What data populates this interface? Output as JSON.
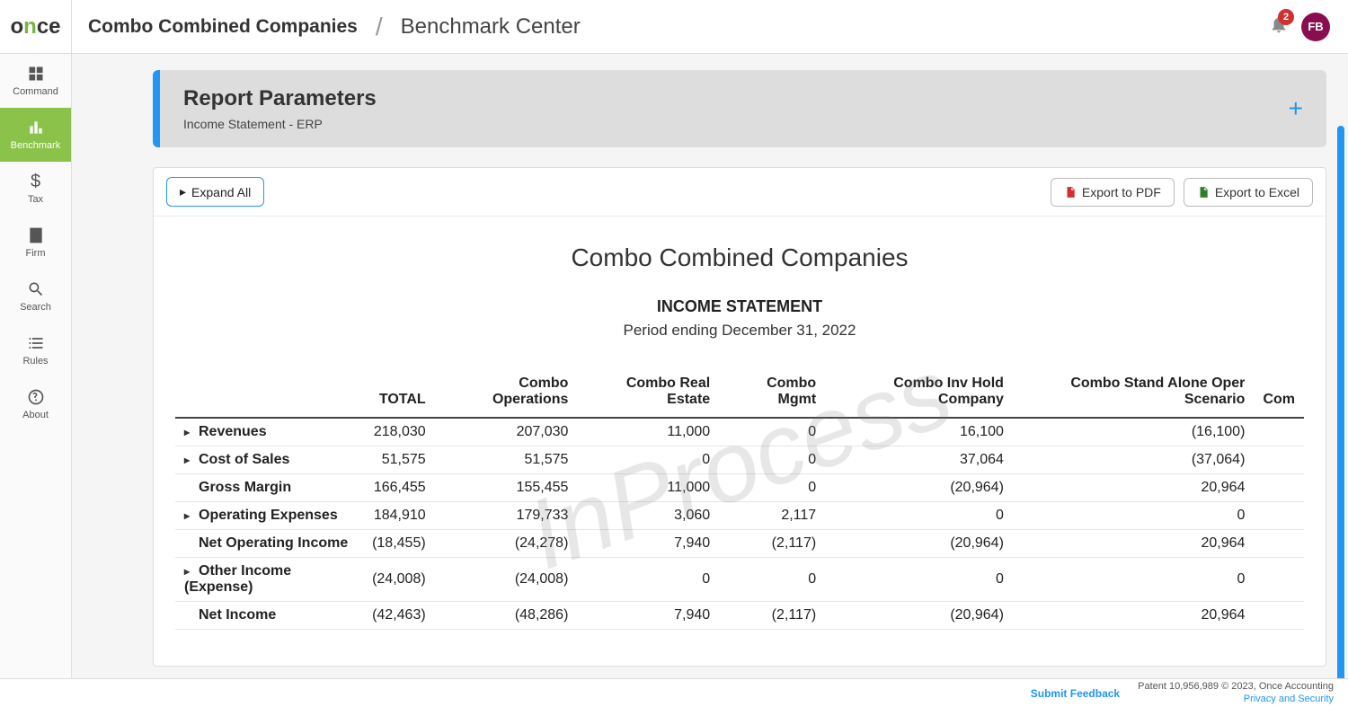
{
  "brand": {
    "prefix": "o",
    "mid": "n",
    "suffix": "ce"
  },
  "header": {
    "company": "Combo Combined Companies",
    "page": "Benchmark Center",
    "notif_count": "2",
    "avatar_initials": "FB"
  },
  "sidebar": {
    "items": [
      {
        "key": "command",
        "label": "Command"
      },
      {
        "key": "benchmark",
        "label": "Benchmark"
      },
      {
        "key": "tax",
        "label": "Tax"
      },
      {
        "key": "firm",
        "label": "Firm"
      },
      {
        "key": "search",
        "label": "Search"
      },
      {
        "key": "rules",
        "label": "Rules"
      },
      {
        "key": "about",
        "label": "About"
      }
    ],
    "active": "benchmark"
  },
  "params": {
    "title": "Report Parameters",
    "subtitle": "Income Statement - ERP"
  },
  "toolbar": {
    "expand_label": "Expand All",
    "export_pdf_label": "Export to PDF",
    "export_excel_label": "Export to Excel"
  },
  "report": {
    "company": "Combo Combined Companies",
    "statement": "INCOME STATEMENT",
    "period": "Period ending December 31, 2022",
    "watermark": "InProcess",
    "columns": [
      "",
      "TOTAL",
      "Combo Operations",
      "Combo Real Estate",
      "Combo Mgmt",
      "Combo Inv Hold Company",
      "Combo Stand Alone Oper Scenario",
      "Com"
    ],
    "rows": [
      {
        "label": "Revenues",
        "expandable": true,
        "values": [
          "218,030",
          "207,030",
          "11,000",
          "0",
          "16,100",
          "(16,100)",
          ""
        ]
      },
      {
        "label": "Cost of Sales",
        "expandable": true,
        "values": [
          "51,575",
          "51,575",
          "0",
          "0",
          "37,064",
          "(37,064)",
          ""
        ]
      },
      {
        "label": "Gross Margin",
        "expandable": false,
        "values": [
          "166,455",
          "155,455",
          "11,000",
          "0",
          "(20,964)",
          "20,964",
          ""
        ]
      },
      {
        "label": "Operating Expenses",
        "expandable": true,
        "values": [
          "184,910",
          "179,733",
          "3,060",
          "2,117",
          "0",
          "0",
          ""
        ]
      },
      {
        "label": "Net Operating Income",
        "expandable": false,
        "values": [
          "(18,455)",
          "(24,278)",
          "7,940",
          "(2,117)",
          "(20,964)",
          "20,964",
          ""
        ]
      },
      {
        "label": "Other Income (Expense)",
        "expandable": true,
        "values": [
          "(24,008)",
          "(24,008)",
          "0",
          "0",
          "0",
          "0",
          ""
        ]
      },
      {
        "label": "Net Income",
        "expandable": false,
        "values": [
          "(42,463)",
          "(48,286)",
          "7,940",
          "(2,117)",
          "(20,964)",
          "20,964",
          ""
        ]
      }
    ]
  },
  "footer": {
    "feedback": "Submit Feedback",
    "patent": "Patent 10,956,989 © 2023, Once Accounting",
    "privacy": "Privacy and Security"
  }
}
